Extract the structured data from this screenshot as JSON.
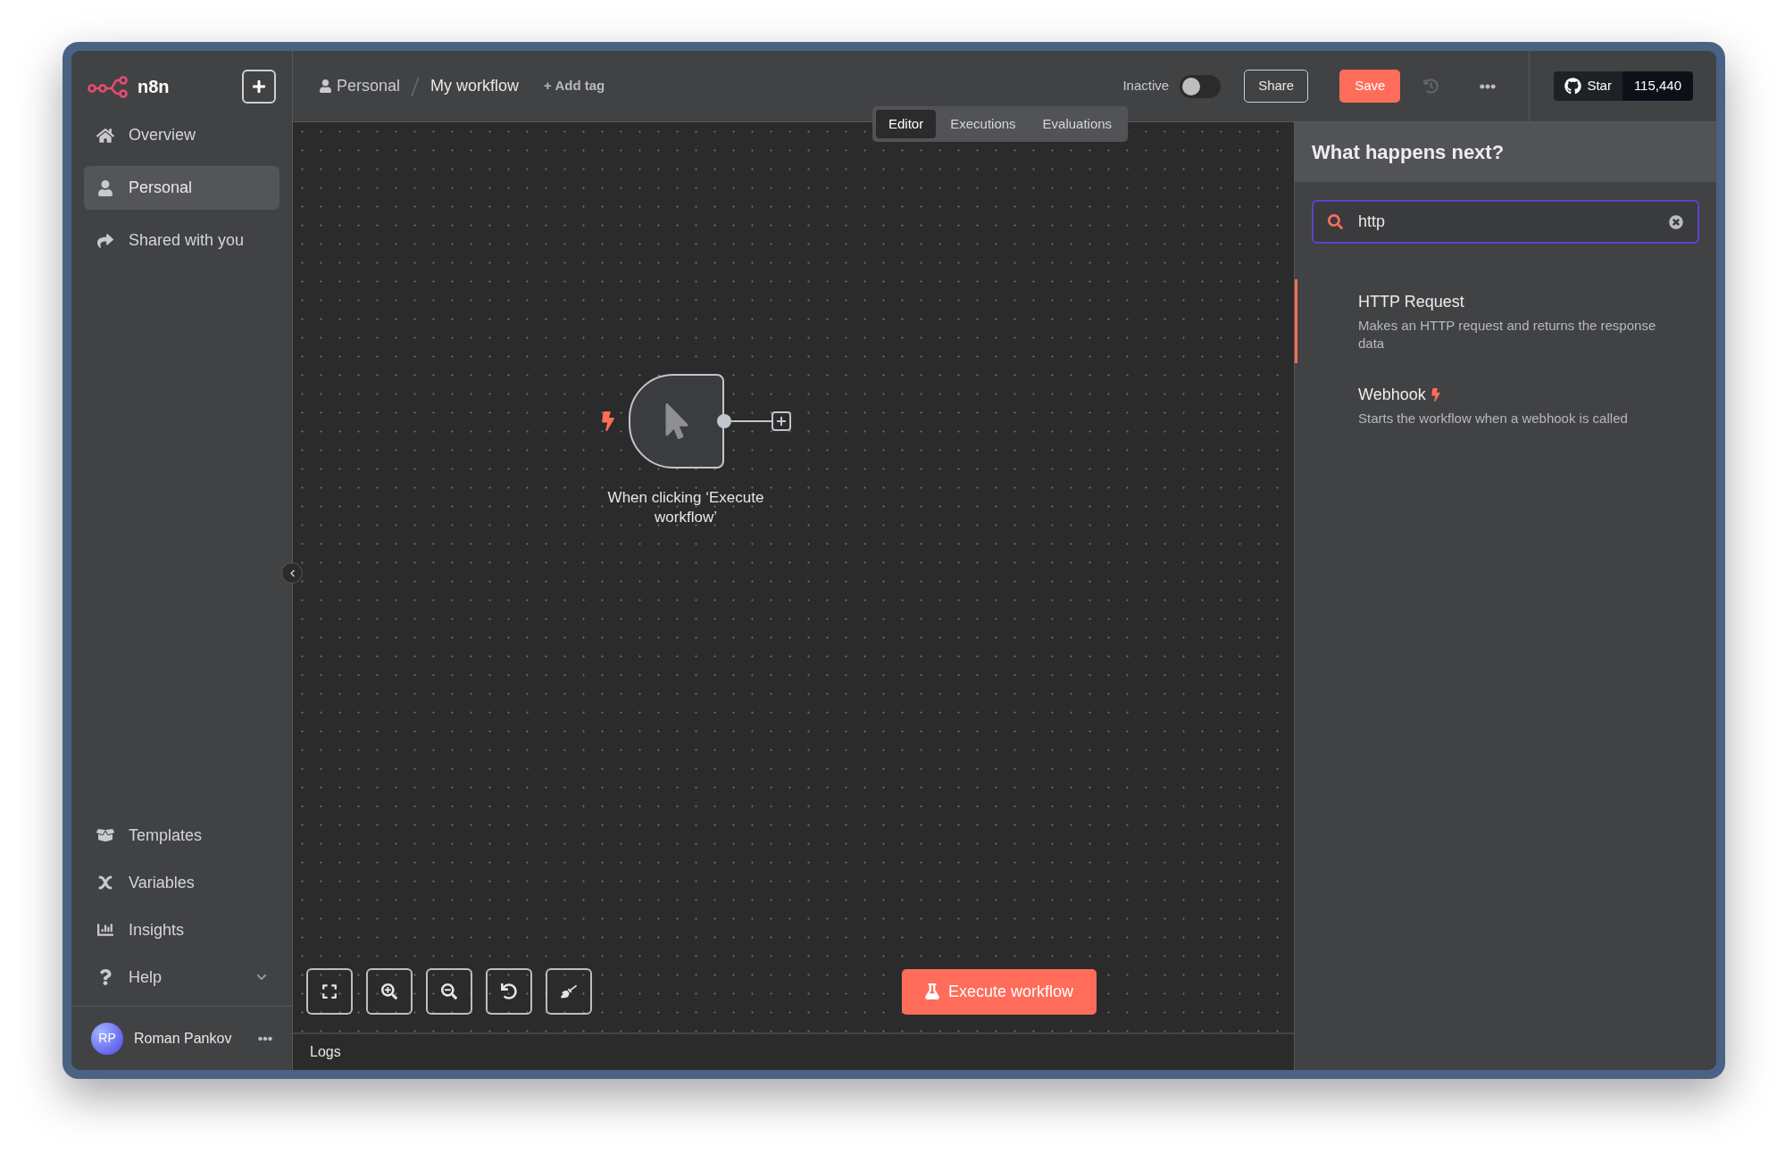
{
  "sidebar": {
    "logo_text": "n8n",
    "nav_items": [
      {
        "label": "Overview",
        "kind": "home",
        "selected": false
      },
      {
        "label": "Personal",
        "kind": "user",
        "selected": true
      },
      {
        "label": "Shared with you",
        "kind": "share",
        "selected": false
      }
    ],
    "bottom_items": [
      {
        "label": "Templates",
        "kind": "box",
        "expandable": false
      },
      {
        "label": "Variables",
        "kind": "variable",
        "expandable": false
      },
      {
        "label": "Insights",
        "kind": "chart",
        "expandable": false
      },
      {
        "label": "Help",
        "kind": "help",
        "expandable": true
      }
    ],
    "user": {
      "initials": "RP",
      "name": "Roman Pankov"
    }
  },
  "header": {
    "project": "Personal",
    "workflow": "My workflow",
    "add_tag": "+ Add tag",
    "active_toggle": {
      "label": "Inactive",
      "on": false
    },
    "share_button": "Share",
    "save_button": "Save",
    "github": {
      "label": "Star",
      "count": "115,440"
    }
  },
  "tabs": [
    {
      "label": "Editor",
      "selected": true
    },
    {
      "label": "Executions",
      "selected": false
    },
    {
      "label": "Evaluations",
      "selected": false
    }
  ],
  "canvas": {
    "node": {
      "label": "When clicking ‘Execute workflow’"
    },
    "execute_button": "Execute workflow",
    "logs": "Logs"
  },
  "panel": {
    "title": "What happens next?",
    "search": {
      "value": "http"
    },
    "results": [
      {
        "title": "HTTP Request",
        "description": "Makes an HTTP request and returns the response data",
        "selected": true,
        "trigger": false
      },
      {
        "title": "Webhook",
        "description": "Starts the workflow when a webhook is called",
        "selected": false,
        "trigger": true
      }
    ]
  }
}
